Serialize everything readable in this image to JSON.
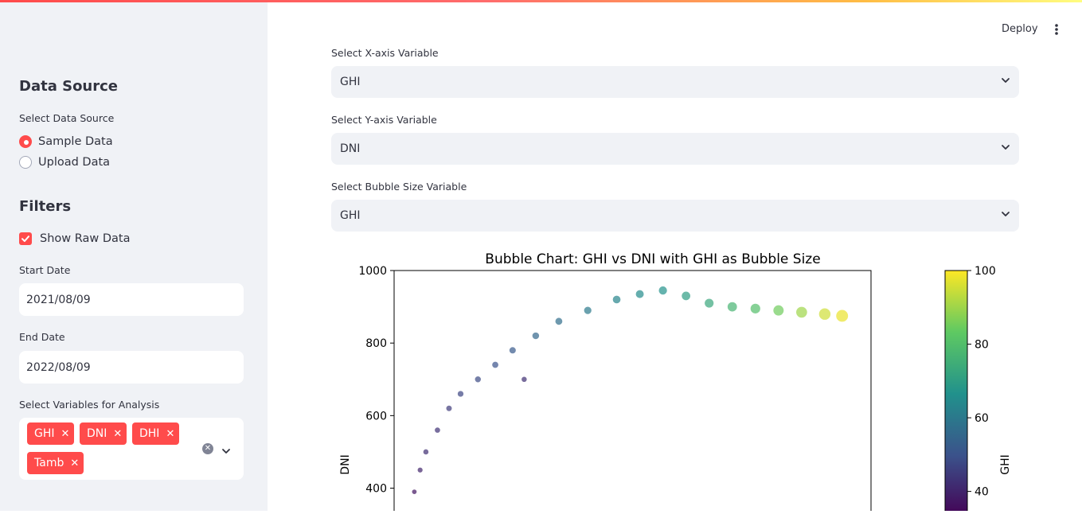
{
  "sidebar": {
    "data_source_heading": "Data Source",
    "data_source_label": "Select Data Source",
    "data_source_options": [
      {
        "label": "Sample Data",
        "selected": true
      },
      {
        "label": "Upload Data",
        "selected": false
      }
    ],
    "filters_heading": "Filters",
    "show_raw_data_label": "Show Raw Data",
    "show_raw_data_checked": true,
    "start_date_label": "Start Date",
    "start_date_value": "2021/08/09",
    "end_date_label": "End Date",
    "end_date_value": "2022/08/09",
    "variables_label": "Select Variables for Analysis",
    "selected_variables": [
      "GHI",
      "DNI",
      "DHI",
      "Tamb"
    ]
  },
  "header": {
    "deploy_label": "Deploy",
    "menu_icon": "more-vert-icon"
  },
  "controls": {
    "x_axis_label": "Select X-axis Variable",
    "x_axis_value": "GHI",
    "y_axis_label": "Select Y-axis Variable",
    "y_axis_value": "DNI",
    "bubble_label": "Select Bubble Size Variable",
    "bubble_value": "GHI"
  },
  "colors": {
    "accent": "#ff4b4b",
    "sidebar_bg": "#f0f2f6",
    "text": "#31333f"
  },
  "chart_data": {
    "type": "scatter",
    "title": "Bubble Chart: GHI vs DNI with GHI as Bubble Size",
    "xlabel": "",
    "ylabel": "DNI",
    "ylim": [
      320,
      1000
    ],
    "yticks": [
      400,
      600,
      800,
      1000
    ],
    "colorbar": {
      "label": "GHI",
      "ticks": [
        40,
        60,
        80,
        100
      ],
      "range": [
        33,
        100
      ],
      "colormap": "viridis"
    },
    "points": [
      {
        "x": 2,
        "y": 390,
        "c": 37
      },
      {
        "x": 4,
        "y": 450,
        "c": 40
      },
      {
        "x": 6,
        "y": 500,
        "c": 42
      },
      {
        "x": 10,
        "y": 560,
        "c": 43
      },
      {
        "x": 14,
        "y": 620,
        "c": 45
      },
      {
        "x": 18,
        "y": 660,
        "c": 47
      },
      {
        "x": 24,
        "y": 700,
        "c": 48
      },
      {
        "x": 30,
        "y": 740,
        "c": 50
      },
      {
        "x": 36,
        "y": 780,
        "c": 52
      },
      {
        "x": 44,
        "y": 820,
        "c": 55
      },
      {
        "x": 52,
        "y": 860,
        "c": 57
      },
      {
        "x": 62,
        "y": 890,
        "c": 60
      },
      {
        "x": 72,
        "y": 920,
        "c": 63
      },
      {
        "x": 80,
        "y": 935,
        "c": 65
      },
      {
        "x": 88,
        "y": 945,
        "c": 67
      },
      {
        "x": 96,
        "y": 930,
        "c": 70
      },
      {
        "x": 104,
        "y": 910,
        "c": 73
      },
      {
        "x": 112,
        "y": 900,
        "c": 77
      },
      {
        "x": 120,
        "y": 895,
        "c": 80
      },
      {
        "x": 128,
        "y": 890,
        "c": 85
      },
      {
        "x": 136,
        "y": 885,
        "c": 90
      },
      {
        "x": 144,
        "y": 880,
        "c": 95
      },
      {
        "x": 150,
        "y": 875,
        "c": 98
      },
      {
        "x": 40,
        "y": 700,
        "c": 42
      }
    ]
  }
}
